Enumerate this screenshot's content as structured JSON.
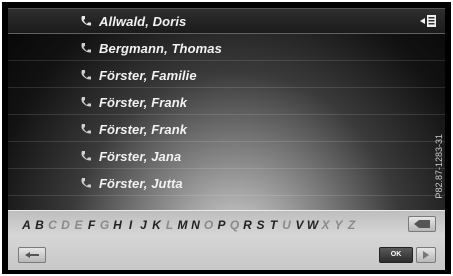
{
  "contacts": [
    {
      "name": "Allwald, Doris",
      "icon": "phone-icon",
      "selected": true
    },
    {
      "name": "Bergmann, Thomas",
      "icon": "phone-icon"
    },
    {
      "name": "Förster, Familie",
      "icon": "phone-icon"
    },
    {
      "name": "Förster, Frank",
      "icon": "phone-icon"
    },
    {
      "name": "Förster, Frank",
      "icon": "phone-icon"
    },
    {
      "name": "Förster, Jana",
      "icon": "phone-icon"
    },
    {
      "name": "Förster, Jutta",
      "icon": "phone-icon"
    }
  ],
  "keyboard": {
    "letters": [
      {
        "char": "A",
        "active": true
      },
      {
        "char": "B",
        "active": true
      },
      {
        "char": "C",
        "active": false
      },
      {
        "char": "D",
        "active": false
      },
      {
        "char": "E",
        "active": false
      },
      {
        "char": "F",
        "active": true
      },
      {
        "char": "G",
        "active": false
      },
      {
        "char": "H",
        "active": true
      },
      {
        "char": "I",
        "active": true
      },
      {
        "char": "J",
        "active": true
      },
      {
        "char": "K",
        "active": true
      },
      {
        "char": "L",
        "active": false
      },
      {
        "char": "M",
        "active": true
      },
      {
        "char": "N",
        "active": true
      },
      {
        "char": "O",
        "active": false
      },
      {
        "char": "P",
        "active": true
      },
      {
        "char": "Q",
        "active": false
      },
      {
        "char": "R",
        "active": true
      },
      {
        "char": "S",
        "active": true
      },
      {
        "char": "T",
        "active": true
      },
      {
        "char": "U",
        "active": false
      },
      {
        "char": "V",
        "active": true
      },
      {
        "char": "W",
        "active": true
      },
      {
        "char": "X",
        "active": false
      },
      {
        "char": "Y",
        "active": false
      },
      {
        "char": "Z",
        "active": false
      }
    ],
    "ok_label": "OK"
  },
  "watermark": "P82.87-1283-31",
  "colors": {
    "background": "#000000",
    "text": "#f2f2f2",
    "keyboard_bg": "#c7c7c7"
  }
}
